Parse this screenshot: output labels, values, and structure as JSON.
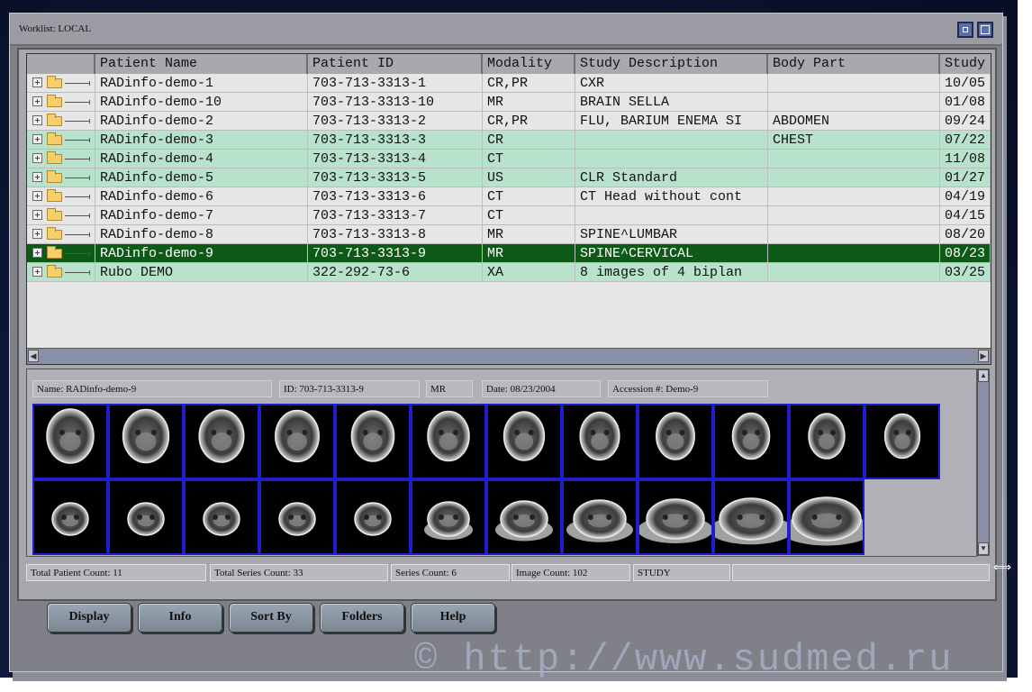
{
  "window": {
    "title": "Worklist: LOCAL"
  },
  "table": {
    "columns": [
      "Patient Name",
      "Patient ID",
      "Modality",
      "Study Description",
      "Body Part",
      "Study"
    ],
    "rows": [
      {
        "name": "RADinfo-demo-1",
        "id": "703-713-3313-1",
        "mod": "CR,PR",
        "desc": "CXR",
        "body": "",
        "study": "10/05",
        "style": "w"
      },
      {
        "name": "RADinfo-demo-10",
        "id": "703-713-3313-10",
        "mod": "MR",
        "desc": "BRAIN SELLA",
        "body": "",
        "study": "01/08",
        "style": "w"
      },
      {
        "name": "RADinfo-demo-2",
        "id": "703-713-3313-2",
        "mod": "CR,PR",
        "desc": "FLU, BARIUM ENEMA SI",
        "body": "ABDOMEN",
        "study": "09/24",
        "style": "w"
      },
      {
        "name": "RADinfo-demo-3",
        "id": "703-713-3313-3",
        "mod": "CR",
        "desc": "",
        "body": "CHEST",
        "study": "07/22",
        "style": "g"
      },
      {
        "name": "RADinfo-demo-4",
        "id": "703-713-3313-4",
        "mod": "CT",
        "desc": "",
        "body": "",
        "study": "11/08",
        "style": "g"
      },
      {
        "name": "RADinfo-demo-5",
        "id": "703-713-3313-5",
        "mod": "US",
        "desc": "CLR Standard",
        "body": "",
        "study": "01/27",
        "style": "g"
      },
      {
        "name": "RADinfo-demo-6",
        "id": "703-713-3313-6",
        "mod": "CT",
        "desc": "CT Head without cont",
        "body": "",
        "study": "04/19",
        "style": "w"
      },
      {
        "name": "RADinfo-demo-7",
        "id": "703-713-3313-7",
        "mod": "CT",
        "desc": "",
        "body": "",
        "study": "04/15",
        "style": "w"
      },
      {
        "name": "RADinfo-demo-8",
        "id": "703-713-3313-8",
        "mod": "MR",
        "desc": "SPINE^LUMBAR",
        "body": "",
        "study": "08/20",
        "style": "w"
      },
      {
        "name": "RADinfo-demo-9",
        "id": "703-713-3313-9",
        "mod": "MR",
        "desc": "SPINE^CERVICAL",
        "body": "",
        "study": "08/23",
        "style": "sel"
      },
      {
        "name": "Rubo DEMO",
        "id": "322-292-73-6",
        "mod": "XA",
        "desc": "8 images of 4 biplan",
        "body": "",
        "study": "03/25",
        "style": "g"
      }
    ]
  },
  "preview": {
    "name": "Name: RADinfo-demo-9",
    "id": "ID: 703-713-3313-9",
    "modality": "MR",
    "date": "Date: 08/23/2004",
    "accession": "Accession #: Demo-9",
    "thumbnail_count": 23
  },
  "status": {
    "patients": "Total Patient Count: 11",
    "series_total": "Total Series Count: 33",
    "series": "Series Count: 6",
    "images": "Image Count: 102",
    "level": "STUDY"
  },
  "buttons": [
    "Display",
    "Info",
    "Sort By",
    "Folders",
    "Help"
  ],
  "watermark": "© http://www.sudmed.ru",
  "colors": {
    "selected_row": "#0d5a16",
    "group_row": "#b8e2cc",
    "thumb_border": "#1d20c8"
  }
}
